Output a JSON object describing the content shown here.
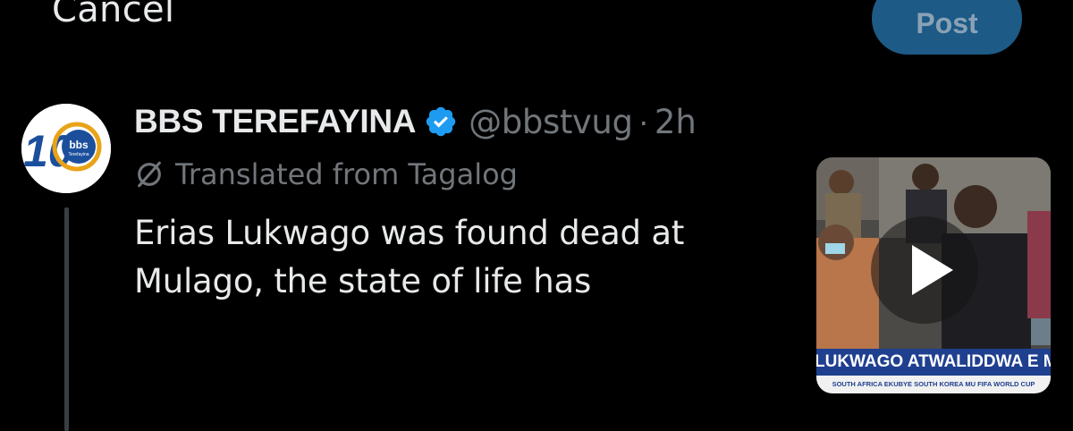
{
  "topbar": {
    "cancel_label": "Cancel",
    "post_label": "Post"
  },
  "tweet": {
    "display_name": "BBS TEREFAYINA",
    "verified": true,
    "handle": "@bbstvug",
    "separator": "·",
    "time": "2h",
    "translated_label": "Translated from Tagalog",
    "text": "Erias Lukwago was found dead at Mulago, the state of life has",
    "avatar": {
      "logo_number": "10",
      "logo_text": "bbs",
      "logo_subtext": "Terefayina"
    },
    "media": {
      "type": "video",
      "ticker": "LUKWAGO ATWALIDDWA E MULAGO",
      "subticker": "SOUTH AFRICA EKUBYE SOUTH KOREA MU FIFA WORLD CUP"
    }
  },
  "colors": {
    "background": "#000000",
    "post_button": "#1d5a86",
    "verified_badge": "#1d9bf0",
    "muted_text": "#71767b",
    "primary_text": "#e7e9ea",
    "thread_line": "#3a3e42"
  },
  "icons": {
    "verified": "verified-badge-icon",
    "translate": "translate-icon",
    "play": "play-icon"
  }
}
